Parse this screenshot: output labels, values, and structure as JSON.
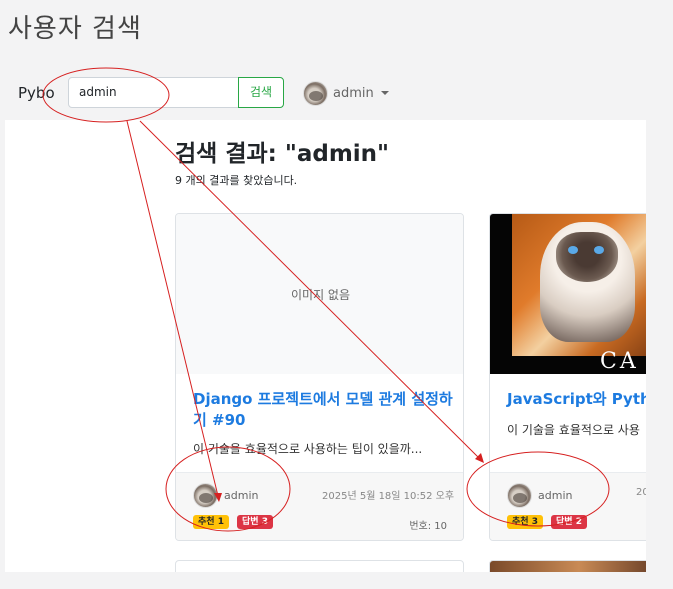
{
  "page": {
    "heading": "사용자 검색"
  },
  "navbar": {
    "brand": "Pybo",
    "search_value": "admin",
    "search_button": "검색",
    "user": "admin"
  },
  "results": {
    "title": "검색 결과: \"admin\"",
    "count_text": "9 개의 결과를 찾았습니다."
  },
  "cards": [
    {
      "image_label": "이미지 없음",
      "title": "Django 프로젝트에서 모델 관계 설정하기 #90",
      "description": "이 기술을 효율적으로 사용하는 팁이 있을까...",
      "author": "admin",
      "date": "2025년 5월 18일 10:52 오후",
      "recommend": "추천 1",
      "answers": "답변 3",
      "number": "번호: 10"
    },
    {
      "image_text": "CA",
      "title": "JavaScript와 Python",
      "description": "이 기술을 효율적으로 사용",
      "author": "admin",
      "date": "20",
      "recommend": "추천 3",
      "answers": "답변 2"
    }
  ],
  "colors": {
    "primary_link": "#1d7be0",
    "success": "#28a745",
    "warning": "#ffc107",
    "danger": "#dc3545",
    "annotation": "#d62020"
  }
}
